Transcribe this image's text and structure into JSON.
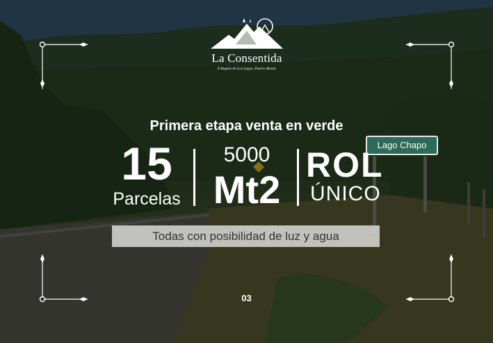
{
  "brand": {
    "name": "La Consentida",
    "subtitle": "X Región de Los Lagos, Puerto Montt."
  },
  "headline": "Primera etapa venta en verde",
  "stats": {
    "parcels_number": "15",
    "parcels_label": "Parcelas",
    "area_number": "5000",
    "area_unit": "Mt2",
    "rol_word": "ROL",
    "rol_label": "ÚNICO"
  },
  "banner": "Todas con posibilidad de luz y agua",
  "page_number": "03",
  "road_sign": "Lago Chapo",
  "colors": {
    "sign_green": "#2d6a58",
    "text": "#ffffff",
    "banner_bg": "#e1e1e1",
    "banner_text": "#333333"
  }
}
